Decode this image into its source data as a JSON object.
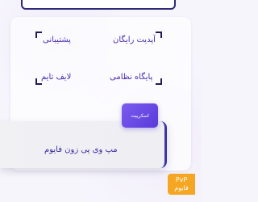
{
  "features": [
    {
      "label": "آپدیت رایگان"
    },
    {
      "label": "پشتیبانی"
    },
    {
      "label": "پایگاه نظامی"
    },
    {
      "label": "لایف تایم"
    }
  ],
  "script_button": {
    "label": "اسکریپت"
  },
  "product": {
    "title": "مپ وی پی زون فایوم"
  },
  "badge": {
    "line1": "PvP",
    "line2": "فایوم"
  },
  "colors": {
    "accent": "#5a3ad8",
    "text": "#4a2fb0",
    "badge": "#f5a623",
    "frame": "#2e2a7a"
  }
}
